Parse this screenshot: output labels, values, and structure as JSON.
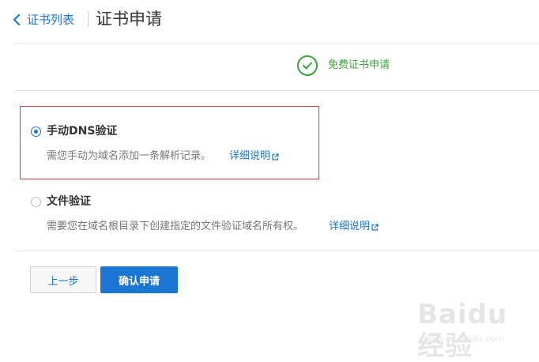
{
  "header": {
    "back_label": "证书列表",
    "title": "证书申请"
  },
  "step": {
    "label": "免费证书申请"
  },
  "options": [
    {
      "label": "手动DNS验证",
      "description": "需您手动为域名添加一条解析记录。",
      "link_label": "详细说明",
      "checked": true
    },
    {
      "label": "文件验证",
      "description": "需要您在域名根目录下创建指定的文件验证域名所有权。",
      "link_label": "详细说明",
      "checked": false
    }
  ],
  "buttons": {
    "prev_label": "上一步",
    "confirm_label": "确认申请"
  },
  "watermark": {
    "brand": "Baidu 经验",
    "sub": "jingyan.baidu.com"
  },
  "colors": {
    "accent": "#1a76d2",
    "success": "#3aa43a",
    "highlight_border": "#d9393b"
  },
  "icons": {
    "back": "chevron-left-icon",
    "step": "check-circle-icon",
    "external": "external-link-icon"
  }
}
